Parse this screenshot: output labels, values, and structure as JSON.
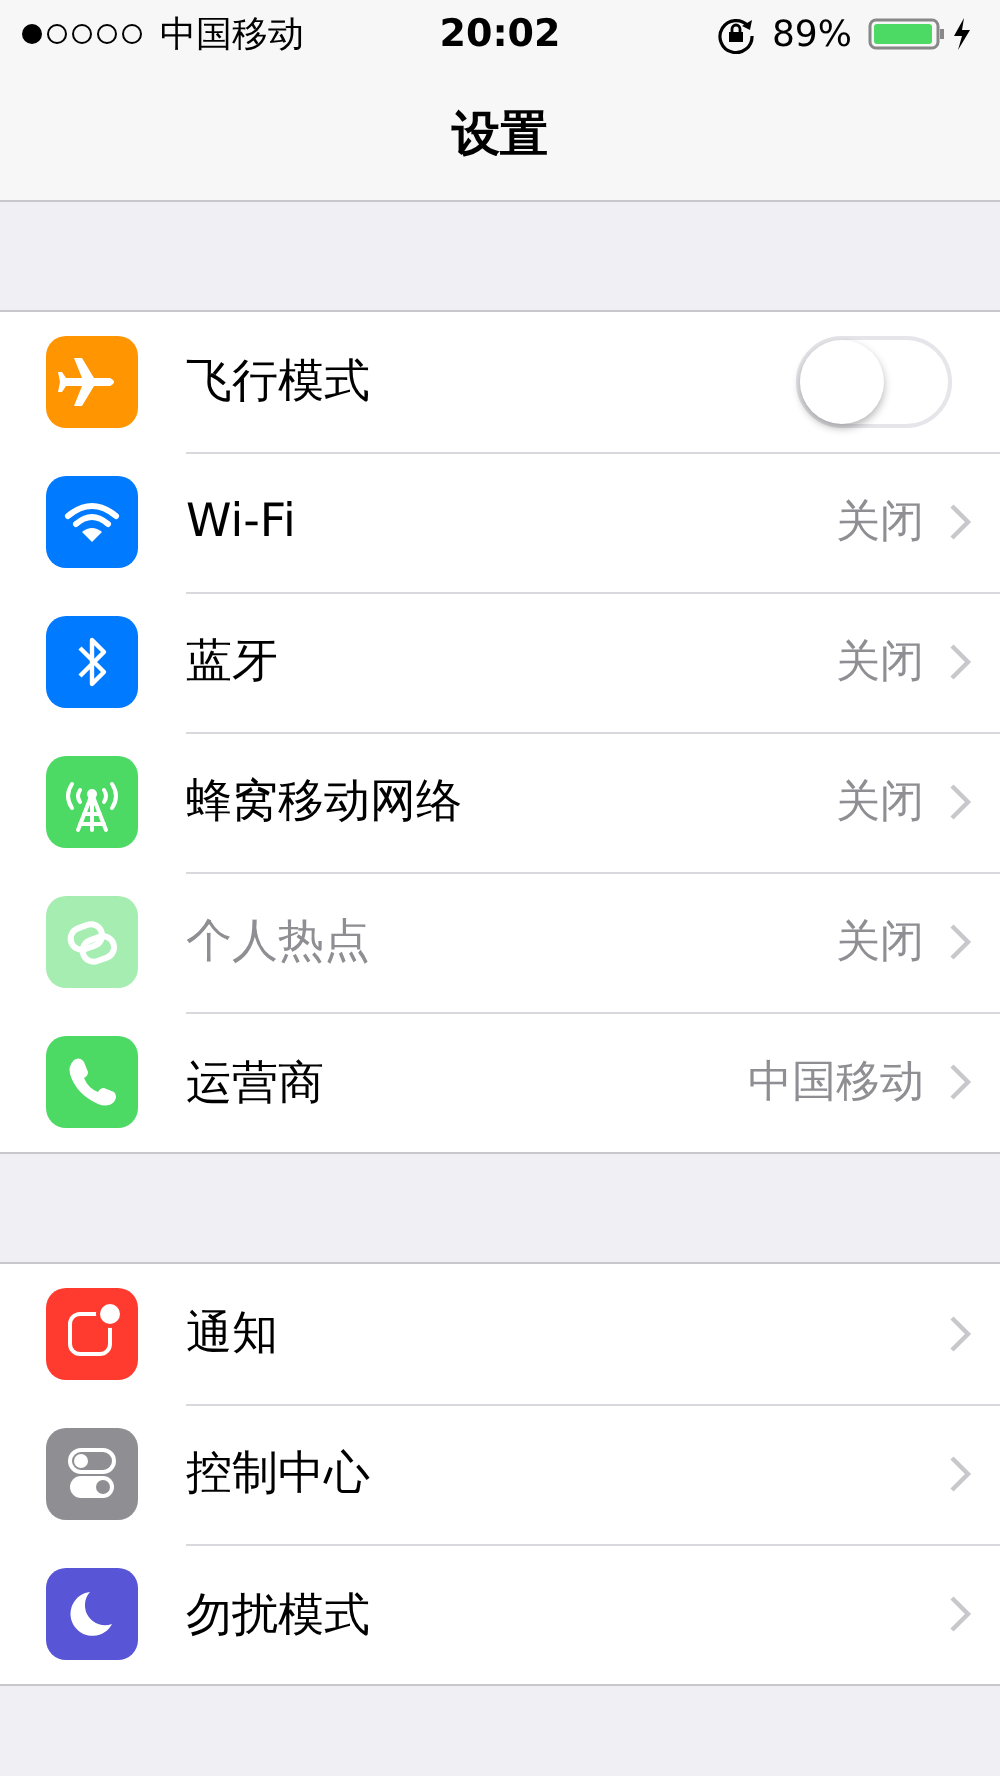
{
  "status_bar": {
    "carrier": "中国移动",
    "time": "20:02",
    "battery": "89%"
  },
  "nav": {
    "title": "设置"
  },
  "groups": [
    {
      "rows": [
        {
          "kind": "toggle",
          "label": "飞行模式",
          "color": "#ff9500",
          "disabled": false,
          "on": false
        },
        {
          "kind": "link",
          "label": "Wi-Fi",
          "value": "关闭",
          "color": "#007aff",
          "disabled": false
        },
        {
          "kind": "link",
          "label": "蓝牙",
          "value": "关闭",
          "color": "#007aff",
          "disabled": false
        },
        {
          "kind": "link",
          "label": "蜂窝移动网络",
          "value": "关闭",
          "color": "#4cd964",
          "disabled": false
        },
        {
          "kind": "link",
          "label": "个人热点",
          "value": "关闭",
          "color": "#a6edb1",
          "disabled": true
        },
        {
          "kind": "link",
          "label": "运营商",
          "value": "中国移动",
          "color": "#4cd964",
          "disabled": false
        }
      ]
    },
    {
      "rows": [
        {
          "kind": "link",
          "label": "通知",
          "color": "#ff3b30",
          "disabled": false
        },
        {
          "kind": "link",
          "label": "控制中心",
          "color": "#8e8e93",
          "disabled": false
        },
        {
          "kind": "link",
          "label": "勿扰模式",
          "color": "#5856d6",
          "disabled": false
        }
      ]
    }
  ]
}
